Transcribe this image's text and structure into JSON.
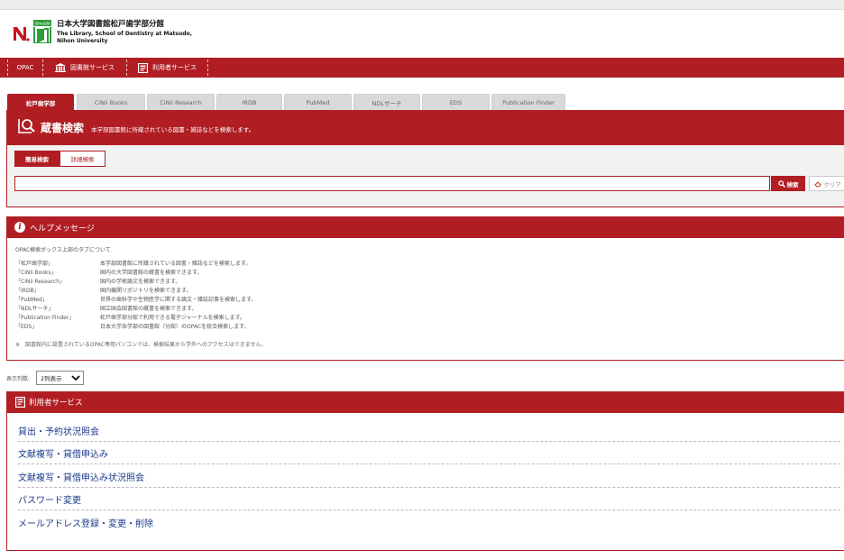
{
  "header": {
    "badge_text": "SinceDM",
    "name_jp": "日本大学図書館松戸歯学部分館",
    "name_en_line1": "The Library, School of Dentistry at Matsudo,",
    "name_en_line2": "Nihon University"
  },
  "nav": {
    "items": [
      {
        "label": "OPAC",
        "icon": "none"
      },
      {
        "label": "図書館サービス",
        "icon": "library-icon"
      },
      {
        "label": "利用者サービス",
        "icon": "book-icon"
      }
    ]
  },
  "tabs": [
    {
      "label": "松戸歯学部",
      "active": true
    },
    {
      "label": "CiNii Books",
      "active": false
    },
    {
      "label": "CiNii Research",
      "active": false
    },
    {
      "label": "IRDB",
      "active": false
    },
    {
      "label": "PubMed",
      "active": false
    },
    {
      "label": "NDLサーチ",
      "active": false
    },
    {
      "label": "EDS",
      "active": false
    },
    {
      "label": "Publication Finder",
      "active": false
    }
  ],
  "search": {
    "title": "蔵書検索",
    "description": "本学部図書館に所蔵されている図書・雑誌などを検索します。",
    "simple_label": "簡易検索",
    "advanced_label": "詳細検索",
    "query": "",
    "search_label": "検索",
    "clear_label": "クリア"
  },
  "help": {
    "title": "ヘルプメッセージ",
    "intro": "OPAC検索ボックス上部のタブについて",
    "rows": [
      {
        "key": "「松戸歯学部」",
        "text": "本学部図書館に所蔵されている図書・雑誌などを検索します。"
      },
      {
        "key": "「CiNii Books」",
        "text": "国内の大学図書館の蔵書を検索できます。"
      },
      {
        "key": "「CiNii Research」",
        "text": "国内の学術論文を検索できます。"
      },
      {
        "key": "「IRDB」",
        "text": "国内機関リポジトリを検索できます。"
      },
      {
        "key": "「PubMed」",
        "text": "世界の歯科学や生物医学に関する論文・雑誌記事を検索します。"
      },
      {
        "key": "「NDLサーチ」",
        "text": "国立国会図書館の蔵書を検索できます。"
      },
      {
        "key": "「Publication Finder」",
        "text": "松戸歯学部分館で利用できる電子ジャーナルを検索します。"
      },
      {
        "key": "「EDS」",
        "text": "日本大学各学部の図書館（分館）のOPACを統合検索します。"
      }
    ],
    "note": "※　図書館内に設置されているOPAC専用パソコンでは、検索結果から学外へのアクセスはできません。"
  },
  "display_cols": {
    "label": "表示列数:",
    "selected": "2列表示"
  },
  "services": {
    "title": "利用者サービス",
    "items": [
      "貸出・予約状況照会",
      "文献複写・貸借申込み",
      "文献複写・貸借申込み状況照会",
      "パスワード変更",
      "メールアドレス登録・変更・削除"
    ]
  },
  "colors": {
    "accent": "#b01e23",
    "link": "#1a3a8a",
    "badge_green": "#2e9e3c"
  }
}
